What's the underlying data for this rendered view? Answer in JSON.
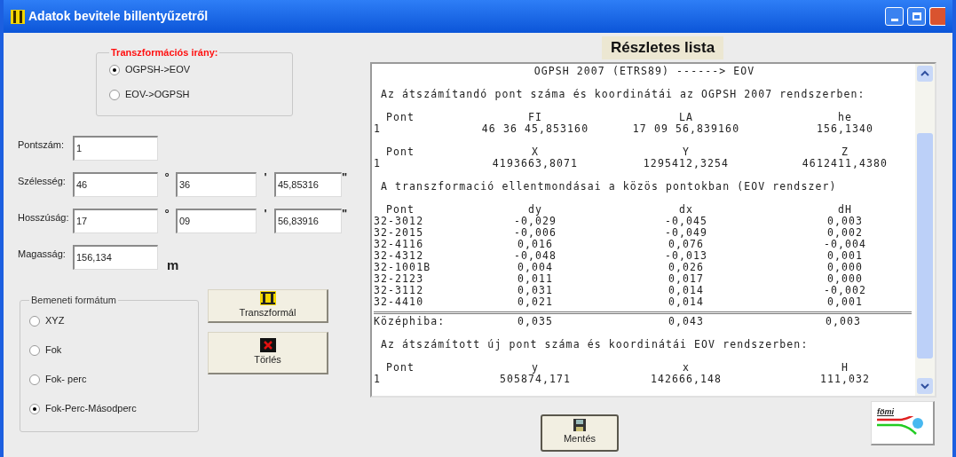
{
  "window": {
    "title": "Adatok bevitele billentyűzetről"
  },
  "direction": {
    "legend": "Transzformációs irány:",
    "options": [
      {
        "label": "OGPSH->EOV",
        "selected": true
      },
      {
        "label": "EOV->OGPSH",
        "selected": false
      }
    ]
  },
  "fields": [
    {
      "label": "Pontszám:",
      "kind": "single",
      "values": [
        "1"
      ]
    },
    {
      "label": "Szélesség:",
      "kind": "dms",
      "values": [
        "46",
        "36",
        "45,85316"
      ],
      "marks": [
        "°",
        "'",
        "\""
      ]
    },
    {
      "label": "Hosszúság:",
      "kind": "dms",
      "values": [
        "17",
        "09",
        "56,83916"
      ],
      "marks": [
        "°",
        "'",
        "\""
      ]
    },
    {
      "label": "Magasság:",
      "kind": "unit",
      "values": [
        "156,134"
      ],
      "unit": "m"
    }
  ],
  "input_format": {
    "legend": "Bemeneti formátum",
    "options": [
      {
        "label": "XYZ",
        "selected": false
      },
      {
        "label": "Fok",
        "selected": false
      },
      {
        "label": "Fok- perc",
        "selected": false
      },
      {
        "label": "Fok-Perc-Másodperc",
        "selected": true
      }
    ]
  },
  "buttons": [
    {
      "label": "Transzformál",
      "kind": "transform"
    },
    {
      "label": "Törlés",
      "kind": "delete"
    }
  ],
  "report": {
    "title": "Részletes lista",
    "blocks": [
      {
        "kind": "center",
        "text": "OGPSH 2007 (ETRS89) ------> EOV"
      },
      {
        "kind": "text",
        "text": "Az átszámítandó pont száma és koordinátái az OGPSH 2007 rendszerben:"
      },
      {
        "kind": "table",
        "rows": [
          {
            "kind": "head",
            "cells": [
              "Pont",
              "FI",
              "LA",
              "he"
            ]
          },
          {
            "kind": "data",
            "cells": [
              "1",
              "46 36 45,853160",
              "17 09 56,839160",
              "156,1340"
            ]
          }
        ]
      },
      {
        "kind": "table",
        "rows": [
          {
            "kind": "head",
            "cells": [
              "Pont",
              "X",
              "Y",
              "Z"
            ]
          },
          {
            "kind": "data",
            "cells": [
              "1",
              "4193663,8071",
              "1295412,3254",
              "4612411,4380"
            ]
          }
        ]
      },
      {
        "kind": "text",
        "text": "A transzformació ellentmondásai a közös pontokban (EOV rendszer)"
      },
      {
        "kind": "table",
        "rows": [
          {
            "kind": "head",
            "cells": [
              "Pont",
              "dy",
              "dx",
              "dH"
            ]
          },
          {
            "kind": "data",
            "cells": [
              "32-3012",
              "-0,029",
              "-0,045",
              "0,003"
            ]
          },
          {
            "kind": "data",
            "cells": [
              "32-2015",
              "-0,006",
              "-0,049",
              "0,002"
            ]
          },
          {
            "kind": "data",
            "cells": [
              "32-4116",
              "0,016",
              "0,076",
              "-0,004"
            ]
          },
          {
            "kind": "data",
            "cells": [
              "32-4312",
              "-0,048",
              "-0,013",
              "0,001"
            ]
          },
          {
            "kind": "data",
            "cells": [
              "32-1001B",
              "0,004",
              "0,026",
              "0,000"
            ]
          },
          {
            "kind": "data",
            "cells": [
              "32-2123",
              "0,011",
              "0,017",
              "0,000"
            ]
          },
          {
            "kind": "data",
            "cells": [
              "32-3112",
              "0,031",
              "0,014",
              "-0,002"
            ]
          },
          {
            "kind": "data",
            "cells": [
              "32-4410",
              "0,021",
              "0,014",
              "0,001"
            ]
          },
          {
            "kind": "total",
            "cells": [
              "Középhiba:",
              "0,035",
              "0,043",
              "0,003"
            ]
          }
        ]
      },
      {
        "kind": "text",
        "text": "Az átszámított új pont száma és koordinátái EOV rendszerben:"
      },
      {
        "kind": "table",
        "rows": [
          {
            "kind": "head",
            "cells": [
              "Pont",
              "y",
              "x",
              "H"
            ]
          },
          {
            "kind": "data",
            "cells": [
              "1",
              "505874,171",
              "142666,148",
              "111,032"
            ]
          }
        ]
      }
    ]
  },
  "save_button": {
    "label": "Mentés"
  },
  "logo": {
    "text": "fömi"
  }
}
